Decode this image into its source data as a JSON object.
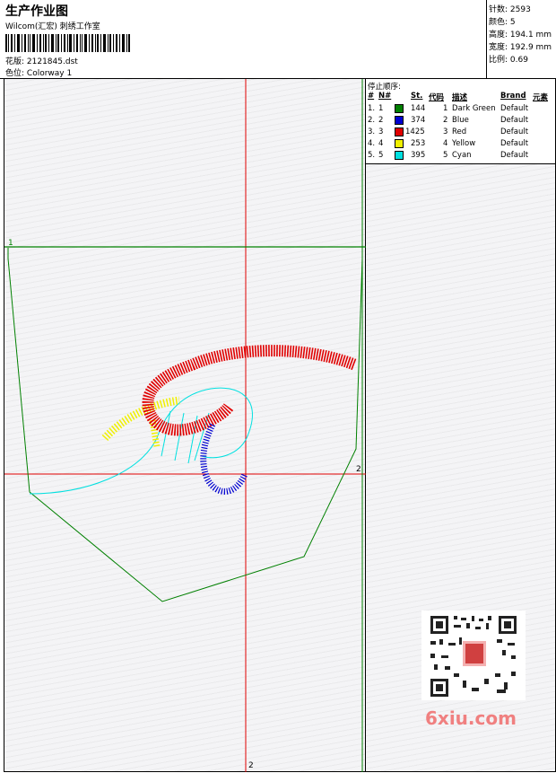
{
  "header": {
    "title": "生产作业图",
    "studio": "Wilcom(汇宏) 刺绣工作室",
    "design_label": "花版: ",
    "design_file": "2121845.dst",
    "colorway_label": "色位: ",
    "colorway": "Colorway 1"
  },
  "stats": [
    {
      "label": "针数: ",
      "value": "2593"
    },
    {
      "label": "颜色: ",
      "value": "5"
    },
    {
      "label": "高度: ",
      "value": "194.1 mm"
    },
    {
      "label": "宽度: ",
      "value": "192.9 mm"
    },
    {
      "label": "比例: ",
      "value": "0.69"
    }
  ],
  "stop_table": {
    "label": "停止顺序:",
    "headers": {
      "hash": "#",
      "n": "N#",
      "st": "St.",
      "code": "代码",
      "desc": "描述",
      "brand": "Brand",
      "element": "元素"
    },
    "rows": [
      {
        "idx": "1.",
        "n": "1",
        "color": "#008000",
        "st": "144",
        "code": "1",
        "desc": "Dark Green",
        "brand": "Default"
      },
      {
        "idx": "2.",
        "n": "2",
        "color": "#0000d0",
        "st": "374",
        "code": "2",
        "desc": "Blue",
        "brand": "Default"
      },
      {
        "idx": "3.",
        "n": "3",
        "color": "#e00000",
        "st": "1425",
        "code": "3",
        "desc": "Red",
        "brand": "Default"
      },
      {
        "idx": "4.",
        "n": "4",
        "color": "#f0f000",
        "st": "253",
        "code": "4",
        "desc": "Yellow",
        "brand": "Default"
      },
      {
        "idx": "5.",
        "n": "5",
        "color": "#00e0e0",
        "st": "395",
        "code": "5",
        "desc": "Cyan",
        "brand": "Default"
      }
    ]
  },
  "markers": {
    "start": "1",
    "right": "2",
    "bottom": "2"
  },
  "watermark": "6xiu.com",
  "colors": {
    "green": "#008000",
    "red": "#e00000",
    "blue": "#0000d0",
    "yellow": "#f0f000",
    "cyan": "#00e0e0",
    "crosshair": "#e00000"
  }
}
